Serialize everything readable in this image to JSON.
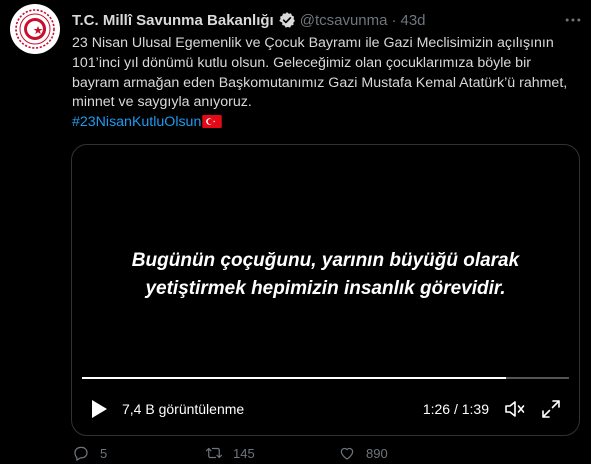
{
  "tweet": {
    "author_name": "T.C. Millî Savunma Bakanlığı",
    "handle": "@tcsavunma",
    "separator": "·",
    "time": "43d",
    "text": "23 Nisan Ulusal Egemenlik ve Çocuk Bayramı ile Gazi Meclisimizin açılışının 101’inci yıl dönümü kutlu olsun. Geleceğimiz olan çocuklarımıza böyle bir bayram armağan eden Başkomutanımız Gazi Mustafa Kemal Atatürk’ü rahmet, minnet ve saygıyla anıyoruz.",
    "hashtag": "#23NisanKutluOlsun"
  },
  "video": {
    "caption_line1": "Bugünün çoçuğunu, yarının büyüğü olarak",
    "caption_line2": "yetiştirmek hepimizin insanlık görevidir.",
    "views": "7,4 B görüntülenme",
    "timecode": "1:26 / 1:39",
    "progress": 0.87
  },
  "actions": {
    "replies": "5",
    "retweets": "145",
    "likes": "890"
  },
  "colors": {
    "background": "#000000",
    "text": "#d9d9d9",
    "muted": "#6e767d",
    "link": "#1d9bf0",
    "verified": "#d9d9d9",
    "flag": "#e30a17",
    "logo": "#c8102e"
  },
  "icons": [
    "ministry-logo-icon",
    "verified-badge-icon",
    "more-icon",
    "turkish-flag-icon",
    "play-icon",
    "volume-icon",
    "fullscreen-icon",
    "reply-icon",
    "retweet-icon",
    "like-icon"
  ]
}
